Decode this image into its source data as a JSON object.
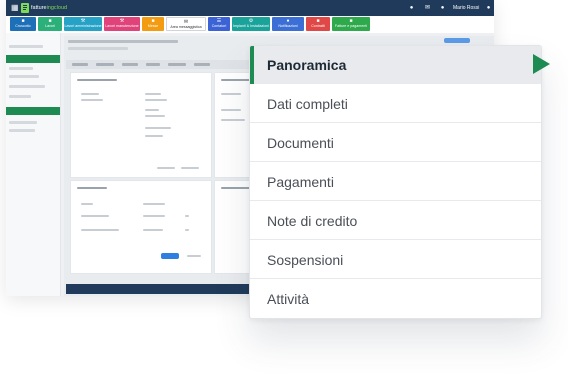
{
  "colors": {
    "accent_green": "#1e8c52",
    "topbar": "#1f3a5a",
    "active_bg": "#e8eaed"
  },
  "topbar": {
    "brand_part1": "fatture",
    "brand_part2": "ingcloud",
    "user_name": "Mario Rossi",
    "icons": [
      "grid-icon",
      "bell-icon",
      "mail-icon",
      "chat-icon",
      "user-icon"
    ]
  },
  "modules": [
    {
      "label": "Cruscotto",
      "color": "#1d6fb8",
      "icon": "dashboard-icon"
    },
    {
      "label": "Lavori",
      "color": "#2bb07a",
      "icon": "briefcase-icon"
    },
    {
      "label": "Lavori amministrazione",
      "color": "#27a2c7",
      "icon": "wrench-icon"
    },
    {
      "label": "Lavori manutenzione",
      "color": "#e0437a",
      "icon": "wrench-icon"
    },
    {
      "label": "Messe",
      "color": "#f39c12",
      "icon": "calendar-icon"
    },
    {
      "label": "Area messaggistica",
      "color": "#ffffff",
      "icon": "envelope-icon"
    },
    {
      "label": "Contatori",
      "color": "#3b63d6",
      "icon": "list-icon"
    },
    {
      "label": "Impianti & Installazioni",
      "color": "#1aa39a",
      "icon": "gear-icon"
    },
    {
      "label": "Notificazioni",
      "color": "#3b6fd6",
      "icon": "bell-icon"
    },
    {
      "label": "Contratti",
      "color": "#e04848",
      "icon": "doc-icon"
    },
    {
      "label": "Fatture e pagamenti",
      "color": "#2eaa4d",
      "icon": "invoice-icon"
    }
  ],
  "menu": {
    "items": [
      {
        "label": "Panoramica",
        "active": true
      },
      {
        "label": "Dati completi",
        "active": false
      },
      {
        "label": "Documenti",
        "active": false
      },
      {
        "label": "Pagamenti",
        "active": false
      },
      {
        "label": "Note di credito",
        "active": false
      },
      {
        "label": "Sospensioni",
        "active": false
      },
      {
        "label": "Attività",
        "active": false
      }
    ]
  }
}
